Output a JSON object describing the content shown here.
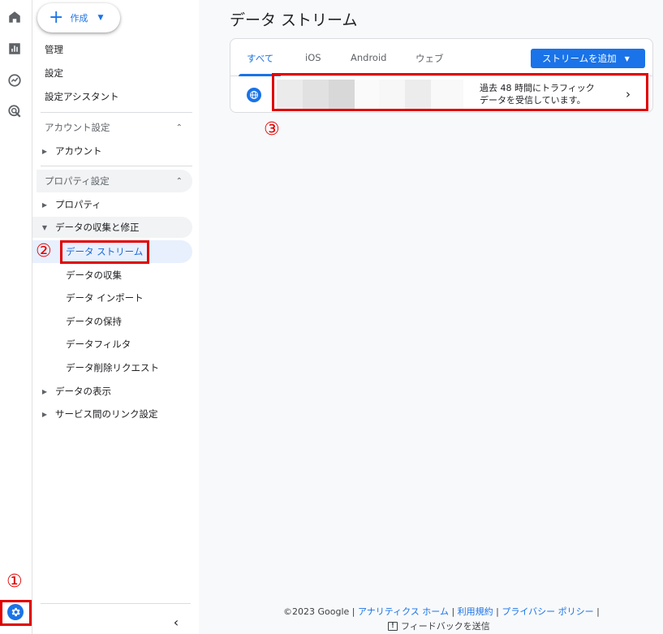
{
  "rail": {
    "icons": [
      "home-icon",
      "reports-icon",
      "explore-icon",
      "advertising-icon",
      "admin-gear-icon"
    ]
  },
  "sidenav": {
    "create_label": "作成",
    "top_items": [
      "管理",
      "設定",
      "設定アシスタント"
    ],
    "account_section": "アカウント設定",
    "account_items": [
      "アカウント"
    ],
    "property_section": "プロパティ設定",
    "property_item": "プロパティ",
    "data_collection_group": "データの収集と修正",
    "data_collection_children": [
      "データ ストリーム",
      "データの収集",
      "データ インポート",
      "データの保持",
      "データフィルタ",
      "データ削除リクエスト"
    ],
    "data_display": "データの表示",
    "service_links": "サービス間のリンク設定"
  },
  "main": {
    "title": "データ ストリーム",
    "tabs": [
      "すべて",
      "iOS",
      "Android",
      "ウェブ"
    ],
    "add_stream_label": "ストリームを追加",
    "stream_status_line1": "過去 48 時間にトラフィック",
    "stream_status_line2": "データを受信しています。"
  },
  "annotations": {
    "step1": "①",
    "step2": "②",
    "step3": "③",
    "color": "#e00000"
  },
  "footer": {
    "copyright": "©2023 Google",
    "links": [
      "アナリティクス ホーム",
      "利用規約",
      "プライバシー ポリシー"
    ],
    "separator": " | ",
    "feedback": "フィードバックを送信"
  },
  "colors": {
    "accent": "#1a73e8",
    "active_bg": "#e8f0fe",
    "annotation": "#e00000"
  }
}
